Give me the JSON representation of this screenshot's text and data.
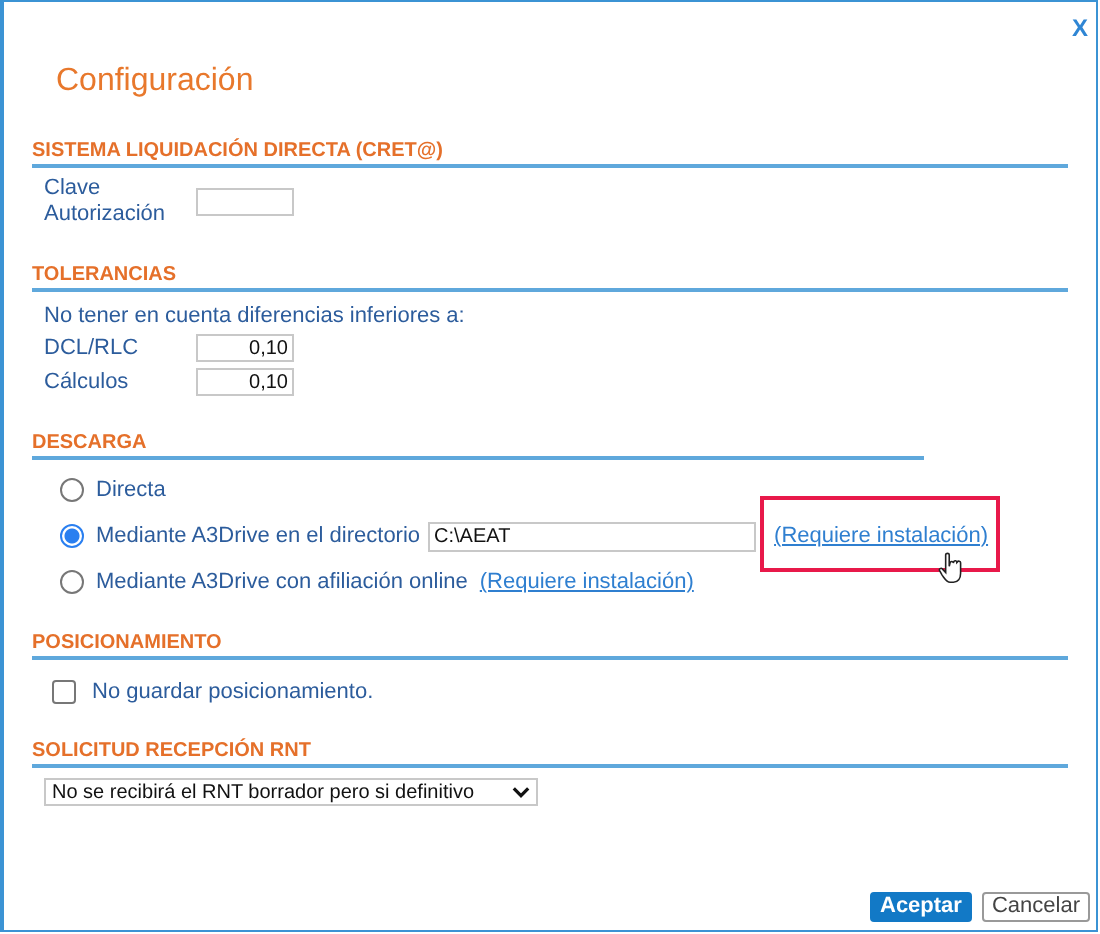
{
  "window": {
    "close": "X",
    "title": "Configuración"
  },
  "cret": {
    "heading": "SISTEMA LIQUIDACIÓN DIRECTA (CRET@)",
    "label": "Clave Autorización"
  },
  "tolerancias": {
    "heading": "TOLERANCIAS",
    "note": "No tener en cuenta diferencias inferiores a:",
    "fields": [
      {
        "label": "DCL/RLC",
        "value": "0,10"
      },
      {
        "label": "Cálculos",
        "value": "0,10"
      }
    ]
  },
  "descarga": {
    "heading": "DESCARGA",
    "options": [
      {
        "label": "Directa",
        "selected": false
      },
      {
        "label": "Mediante A3Drive en el directorio",
        "selected": true,
        "path": "C:\\AEAT",
        "link": "(Requiere instalación)",
        "highlighted": true
      },
      {
        "label": "Mediante A3Drive con afiliación online",
        "selected": false,
        "link": "(Requiere instalación)",
        "highlighted": false
      }
    ]
  },
  "posicionamiento": {
    "heading": "POSICIONAMIENTO",
    "checkbox": {
      "label": "No guardar posicionamiento.",
      "checked": false
    }
  },
  "rnt": {
    "heading": "SOLICITUD RECEPCIÓN RNT",
    "select": "No se recibirá el RNT borrador pero si definitivo"
  },
  "buttons": [
    {
      "label": "Aceptar",
      "kind": "primary"
    },
    {
      "label": "Cancelar",
      "kind": "secondary"
    }
  ]
}
